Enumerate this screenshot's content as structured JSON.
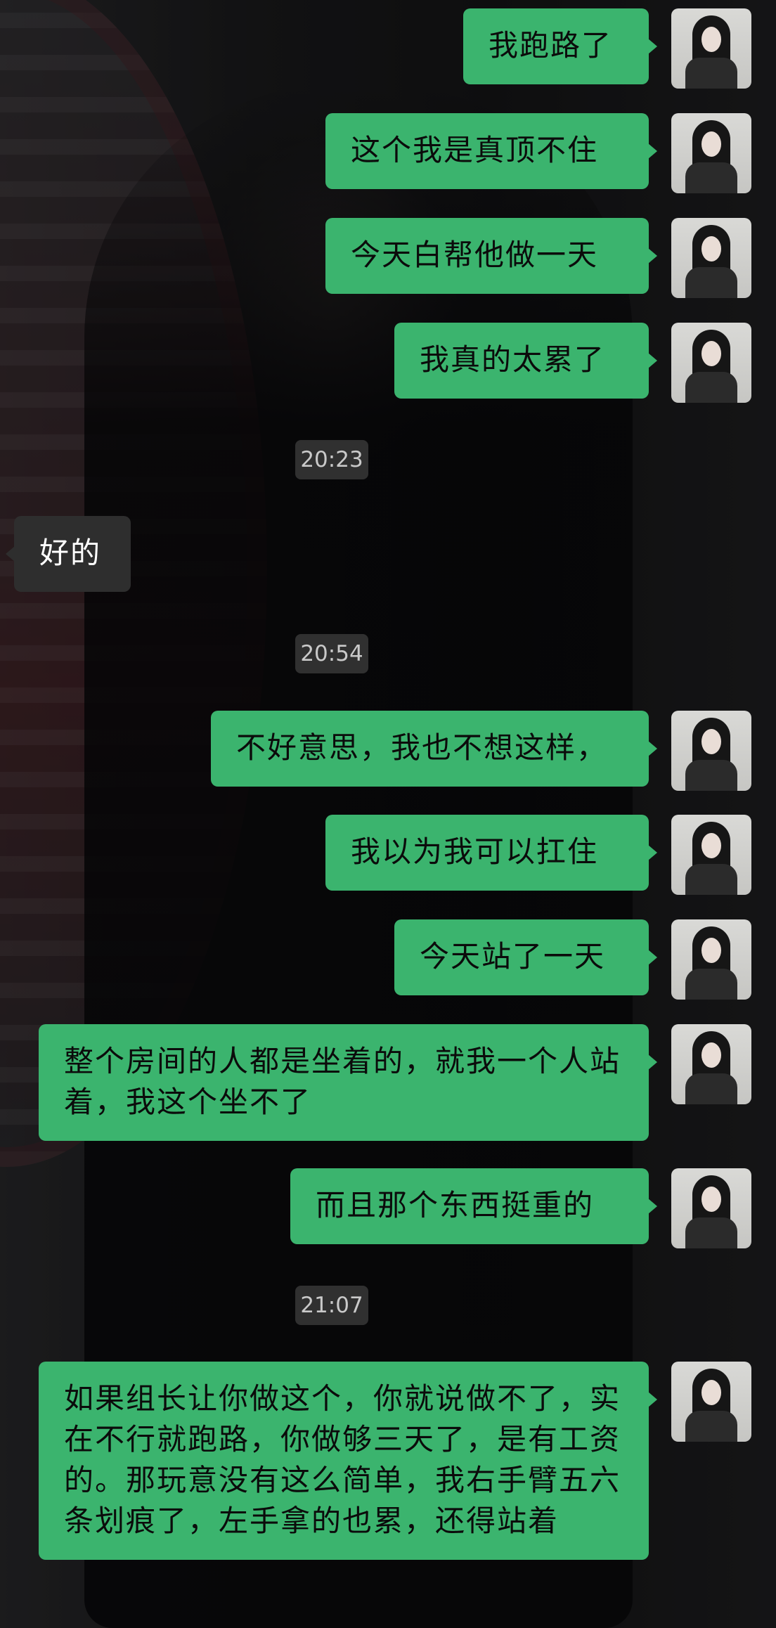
{
  "colors": {
    "outgoing_bubble": "#3bb46e",
    "incoming_bubble": "#2e2e2e",
    "timestamp_bg": "#3c3c3c"
  },
  "messages": [
    {
      "type": "out",
      "text": "我跑路了"
    },
    {
      "type": "out",
      "text": "这个我是真顶不住"
    },
    {
      "type": "out",
      "text": "今天白帮他做一天"
    },
    {
      "type": "out",
      "text": "我真的太累了"
    },
    {
      "type": "time",
      "text": "20:23"
    },
    {
      "type": "in",
      "text": "好的"
    },
    {
      "type": "time",
      "text": "20:54"
    },
    {
      "type": "out",
      "text": "不好意思，我也不想这样，"
    },
    {
      "type": "out",
      "text": "我以为我可以扛住"
    },
    {
      "type": "out",
      "text": "今天站了一天"
    },
    {
      "type": "out",
      "text": "整个房间的人都是坐着的，就我一个人站着，我这个坐不了"
    },
    {
      "type": "out",
      "text": "而且那个东西挺重的"
    },
    {
      "type": "time",
      "text": "21:07"
    },
    {
      "type": "out",
      "text": "如果组长让你做这个，你就说做不了，实在不行就跑路，你做够三天了，是有工资的。那玩意没有这么简单，我右手臂五六条划痕了，左手拿的也累，还得站着"
    }
  ]
}
